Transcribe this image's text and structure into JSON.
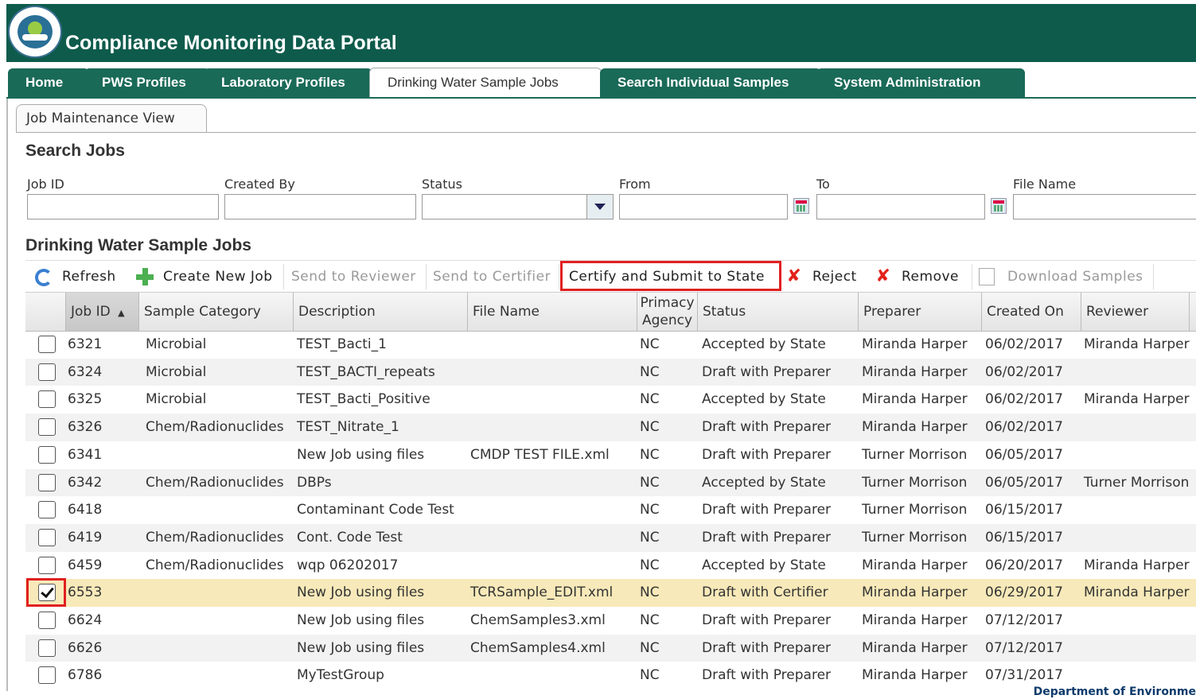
{
  "app": {
    "title": "Compliance Monitoring Data Portal"
  },
  "nav": {
    "tabs": [
      {
        "label": "Home"
      },
      {
        "label": "PWS Profiles"
      },
      {
        "label": "Laboratory Profiles"
      },
      {
        "label": "Drinking Water Sample Jobs"
      },
      {
        "label": "Search Individual Samples"
      },
      {
        "label": "System Administration"
      }
    ],
    "subtab": "Job Maintenance View"
  },
  "search": {
    "title": "Search Jobs",
    "fields": {
      "job_id": {
        "label": "Job ID",
        "value": ""
      },
      "created_by": {
        "label": "Created By",
        "value": ""
      },
      "status": {
        "label": "Status",
        "value": ""
      },
      "from": {
        "label": "From",
        "value": ""
      },
      "to": {
        "label": "To",
        "value": ""
      },
      "file_name": {
        "label": "File Name",
        "value": ""
      }
    }
  },
  "grid": {
    "title": "Drinking Water Sample Jobs",
    "toolbar": {
      "refresh": "Refresh",
      "create": "Create New Job",
      "send_reviewer": "Send to Reviewer",
      "send_certifier": "Send to Certifier",
      "certify": "Certify and Submit to State",
      "reject": "Reject",
      "remove": "Remove",
      "download": "Download Samples"
    },
    "columns": {
      "job_id": "Job ID",
      "category": "Sample Category",
      "description": "Description",
      "file_name": "File Name",
      "primacy_1": "Primacy",
      "primacy_2": "Agency",
      "status": "Status",
      "preparer": "Preparer",
      "created_on": "Created On",
      "reviewer": "Reviewer"
    },
    "rows": [
      {
        "id": "6321",
        "category": "Microbial",
        "description": "TEST_Bacti_1",
        "file": "",
        "agency": "NC",
        "status": "Accepted by State",
        "preparer": "Miranda Harper",
        "created": "06/02/2017",
        "reviewer": "Miranda Harper",
        "checked": false
      },
      {
        "id": "6324",
        "category": "Microbial",
        "description": "TEST_BACTI_repeats",
        "file": "",
        "agency": "NC",
        "status": "Draft with Preparer",
        "preparer": "Miranda Harper",
        "created": "06/02/2017",
        "reviewer": "",
        "checked": false
      },
      {
        "id": "6325",
        "category": "Microbial",
        "description": "TEST_Bacti_Positive",
        "file": "",
        "agency": "NC",
        "status": "Accepted by State",
        "preparer": "Miranda Harper",
        "created": "06/02/2017",
        "reviewer": "Miranda Harper",
        "checked": false
      },
      {
        "id": "6326",
        "category": "Chem/Radionuclides",
        "description": "TEST_Nitrate_1",
        "file": "",
        "agency": "NC",
        "status": "Draft with Preparer",
        "preparer": "Miranda Harper",
        "created": "06/02/2017",
        "reviewer": "",
        "checked": false
      },
      {
        "id": "6341",
        "category": "",
        "description": "New Job using files",
        "file": "CMDP TEST FILE.xml",
        "agency": "NC",
        "status": "Draft with Preparer",
        "preparer": "Turner Morrison",
        "created": "06/05/2017",
        "reviewer": "",
        "checked": false
      },
      {
        "id": "6342",
        "category": "Chem/Radionuclides",
        "description": "DBPs",
        "file": "",
        "agency": "NC",
        "status": "Accepted by State",
        "preparer": "Turner Morrison",
        "created": "06/05/2017",
        "reviewer": "Turner Morrison",
        "checked": false
      },
      {
        "id": "6418",
        "category": "",
        "description": "Contaminant Code Test",
        "file": "",
        "agency": "NC",
        "status": "Draft with Preparer",
        "preparer": "Turner Morrison",
        "created": "06/15/2017",
        "reviewer": "",
        "checked": false
      },
      {
        "id": "6419",
        "category": "Chem/Radionuclides",
        "description": "Cont. Code Test",
        "file": "",
        "agency": "NC",
        "status": "Draft with Preparer",
        "preparer": "Turner Morrison",
        "created": "06/15/2017",
        "reviewer": "",
        "checked": false
      },
      {
        "id": "6459",
        "category": "Chem/Radionuclides",
        "description": "wqp 06202017",
        "file": "",
        "agency": "NC",
        "status": "Accepted by State",
        "preparer": "Miranda Harper",
        "created": "06/20/2017",
        "reviewer": "Miranda Harper",
        "checked": false
      },
      {
        "id": "6553",
        "category": "",
        "description": "New Job using files",
        "file": "TCRSample_EDIT.xml",
        "agency": "NC",
        "status": "Draft with Certifier",
        "preparer": "Miranda Harper",
        "created": "06/29/2017",
        "reviewer": "Miranda Harper",
        "checked": true
      },
      {
        "id": "6624",
        "category": "",
        "description": "New Job using files",
        "file": "ChemSamples3.xml",
        "agency": "NC",
        "status": "Draft with Preparer",
        "preparer": "Miranda Harper",
        "created": "07/12/2017",
        "reviewer": "",
        "checked": false
      },
      {
        "id": "6626",
        "category": "",
        "description": "New Job using files",
        "file": "ChemSamples4.xml",
        "agency": "NC",
        "status": "Draft with Preparer",
        "preparer": "Miranda Harper",
        "created": "07/12/2017",
        "reviewer": "",
        "checked": false
      },
      {
        "id": "6786",
        "category": "",
        "description": "MyTestGroup",
        "file": "",
        "agency": "NC",
        "status": "Draft with Preparer",
        "preparer": "Miranda Harper",
        "created": "07/31/2017",
        "reviewer": "",
        "checked": false
      }
    ]
  },
  "footer": {
    "text": "Department of Environme"
  },
  "colors": {
    "header_green": "#0e5b4c",
    "tab_green": "#1a6a58",
    "selected_row": "#f7e9b9",
    "highlight_red": "#e02020"
  }
}
